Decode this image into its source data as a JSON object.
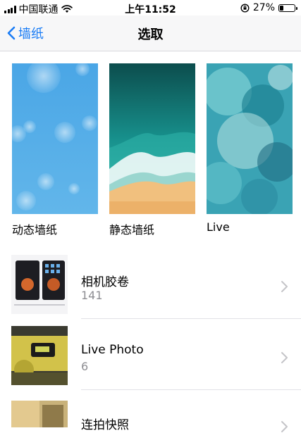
{
  "status": {
    "carrier": "中国联通",
    "time": "上午11:52",
    "battery": "27%",
    "battery_level": 0.27,
    "icons": [
      "signal-icon",
      "wifi-icon",
      "rotation-lock-icon",
      "battery-icon"
    ]
  },
  "nav": {
    "back_label": "墙纸",
    "title": "选取"
  },
  "wallpapers": [
    {
      "label": "动态墙纸"
    },
    {
      "label": "静态墙纸"
    },
    {
      "label": "Live"
    }
  ],
  "albums": [
    {
      "name": "相机胶卷",
      "count": "141"
    },
    {
      "name": "Live Photo",
      "count": "6"
    },
    {
      "name": "连拍快照",
      "count": ""
    }
  ],
  "colors": {
    "accent": "#1a7cf5",
    "secondary_text": "#8e8e93",
    "nav_bg": "#f7f7f8"
  }
}
